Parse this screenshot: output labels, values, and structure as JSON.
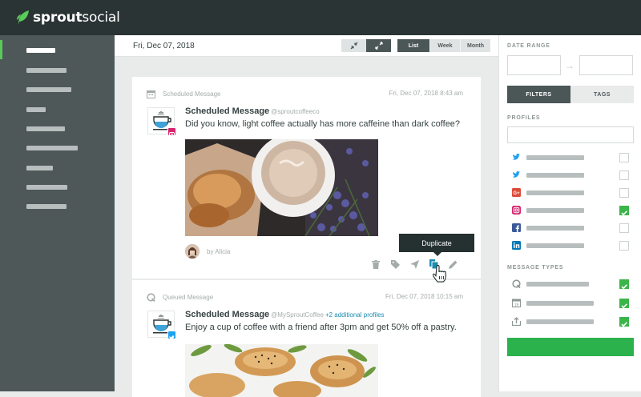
{
  "app": {
    "brand_bold": "sprout",
    "brand_light": "social",
    "brand_color": "#59cb59"
  },
  "sidebar": {
    "items": [
      {
        "icon": "none",
        "active": true
      },
      {
        "icon": "none",
        "active": false
      },
      {
        "icon": "none",
        "active": false
      },
      {
        "icon": "none",
        "active": false
      },
      {
        "icon": "none",
        "active": false
      },
      {
        "icon": "none",
        "active": false
      },
      {
        "icon": "none",
        "active": false
      },
      {
        "icon": "none",
        "active": false
      },
      {
        "icon": "none",
        "active": false
      }
    ]
  },
  "toolbar": {
    "date": "Fri, Dec 07, 2018",
    "collapse_icon": "collapse-icon",
    "expand_icon": "expand-icon",
    "views": [
      "List",
      "Week",
      "Month"
    ],
    "active_view": "List"
  },
  "messages": [
    {
      "status_icon": "calendar-icon",
      "status": "Scheduled Message",
      "timestamp": "Fri, Dec 07, 2018 8:43 am",
      "title": "Scheduled Message",
      "handle": "@sproutcoffeeco",
      "extra_profiles": "",
      "network": "instagram",
      "body": "Did you know, light coffee actually has more caffeine than dark coffee?",
      "author": "by Alicia",
      "actions": [
        "trash-icon",
        "tag-icon",
        "send-icon",
        "duplicate-icon",
        "pencil-icon"
      ],
      "tooltip": "Duplicate"
    },
    {
      "status_icon": "queue-icon",
      "status": "Queued Message",
      "timestamp": "Fri, Dec 07, 2018 10:15 am",
      "title": "Scheduled Message",
      "handle": "@MySproutCoffee",
      "extra_profiles": "+2 additional profiles",
      "network": "twitter",
      "body": "Enjoy a cup of coffee with a friend after 3pm and get 50% off a pastry."
    }
  ],
  "filters_panel": {
    "date_range_label": "DATE RANGE",
    "tabs": [
      "FILTERS",
      "TAGS"
    ],
    "active_tab": "FILTERS",
    "profiles_label": "PROFILES",
    "profiles": [
      {
        "network": "twitter",
        "icon": "twitter-icon",
        "color": "#1da1f2",
        "checked": false
      },
      {
        "network": "twitter",
        "icon": "twitter-icon",
        "color": "#1da1f2",
        "checked": false
      },
      {
        "network": "google-plus",
        "icon": "google-plus-icon",
        "color": "#dd4b39",
        "checked": false
      },
      {
        "network": "instagram",
        "icon": "instagram-icon",
        "color": "#d6246e",
        "checked": true
      },
      {
        "network": "facebook",
        "icon": "facebook-icon",
        "color": "#3b5998",
        "checked": false
      },
      {
        "network": "linkedin",
        "icon": "linkedin-icon",
        "color": "#0077b5",
        "checked": false
      }
    ],
    "message_types_label": "MESSAGE TYPES",
    "message_types": [
      {
        "icon": "queue-icon",
        "checked": true
      },
      {
        "icon": "calendar-icon",
        "checked": true
      },
      {
        "icon": "upload-icon",
        "checked": true
      }
    ],
    "apply_color": "#2bb24c"
  }
}
